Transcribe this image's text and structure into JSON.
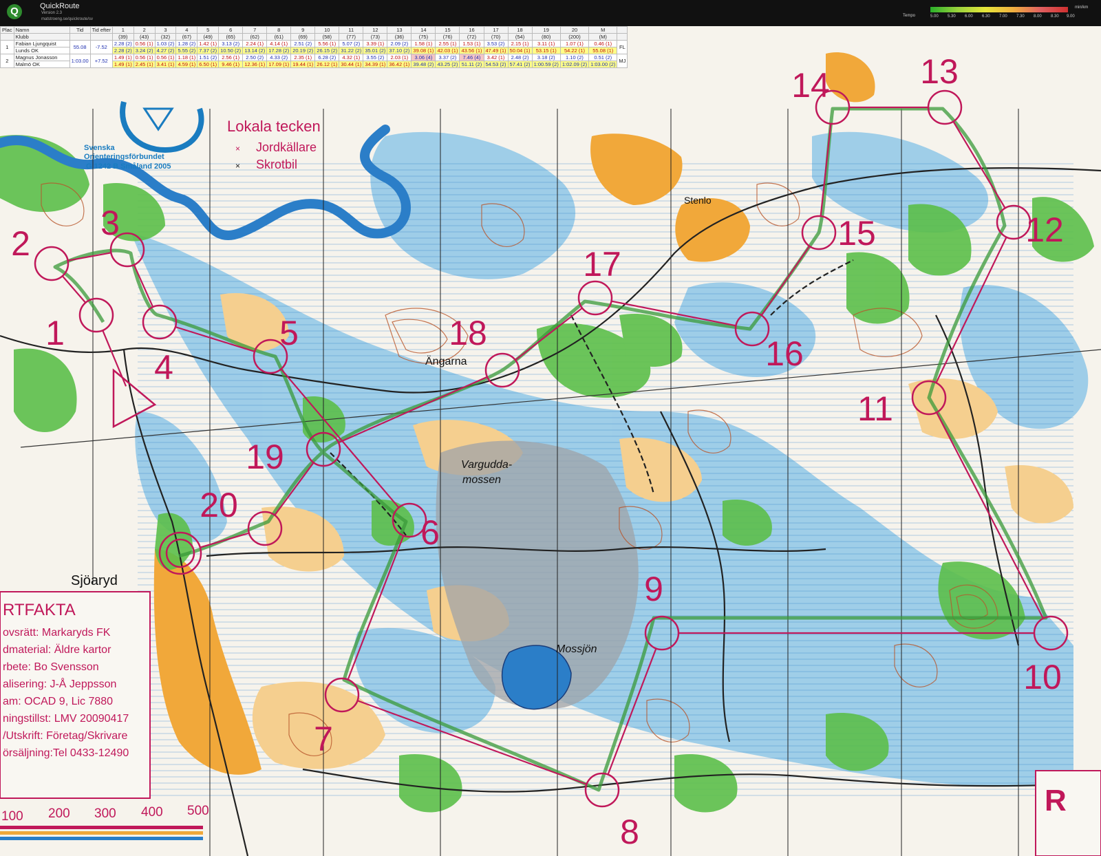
{
  "app": {
    "name": "QuickRoute",
    "version": "Version 2.3",
    "url": "matstroeng.se/quickroute/sv"
  },
  "tempo_legend": {
    "title": "Tempo",
    "ticks": [
      "5.00",
      "5.30",
      "6.00",
      "6.30",
      "7.00",
      "7.30",
      "8.00",
      "8.30",
      "9.00"
    ],
    "unit": "min/km"
  },
  "split_table": {
    "headers_top": [
      "Plac",
      "Namn",
      "Tid",
      "Tid efter",
      "1",
      "2",
      "3",
      "4",
      "5",
      "6",
      "7",
      "8",
      "9",
      "10",
      "11",
      "12",
      "13",
      "14",
      "15",
      "16",
      "17",
      "18",
      "19",
      "20",
      "M"
    ],
    "headers_bottom": [
      "",
      "Klubb",
      "",
      "",
      "(39)",
      "(43)",
      "(32)",
      "(67)",
      "(49)",
      "(65)",
      "(62)",
      "(61)",
      "(69)",
      "(58)",
      "(77)",
      "(73)",
      "(36)",
      "(75)",
      "(76)",
      "(72)",
      "(70)",
      "(54)",
      "(80)",
      "(200)",
      "(M)"
    ],
    "runners": [
      {
        "place": "1",
        "name": "Fabian Ljungquist",
        "club": "Lunds OK",
        "time": "55.08",
        "behind": "-7.52",
        "initials": "FL",
        "legs": [
          "2.28 (2)",
          "0.56 (1)",
          "1.03 (2)",
          "1.28 (2)",
          "1.42 (1)",
          "3.13 (2)",
          "2.24 (1)",
          "4.14 (1)",
          "2.51 (2)",
          "5.56 (1)",
          "5.07 (2)",
          "3.39 (1)",
          "2.09 (2)",
          "1.58 (1)",
          "2.55 (1)",
          "1.53 (1)",
          "3.53 (2)",
          "2.15 (1)",
          "3.11 (1)",
          "1.07 (1)",
          "0.46 (1)"
        ],
        "cumulative": [
          "2.28 (2)",
          "3.24 (2)",
          "4.27 (2)",
          "5.55 (2)",
          "7.37 (2)",
          "10.50 (2)",
          "13.14 (2)",
          "17.28 (2)",
          "20.19 (2)",
          "26.15 (2)",
          "31.22 (2)",
          "35.01 (2)",
          "37.10 (2)",
          "39.08 (1)",
          "42.03 (1)",
          "43.56 (1)",
          "47.49 (1)",
          "50.04 (1)",
          "53.15 (1)",
          "54.22 (1)",
          "55.08 (1)"
        ]
      },
      {
        "place": "2",
        "name": "Magnus Jonasson",
        "club": "Malmö OK",
        "time": "1:03.00",
        "behind": "+7.52",
        "initials": "MJ",
        "legs": [
          "1.49 (1)",
          "0.56 (1)",
          "0.56 (1)",
          "1.18 (1)",
          "1.51 (2)",
          "2.56 (1)",
          "2.50 (2)",
          "4.33 (2)",
          "2.35 (1)",
          "6.28 (2)",
          "4.32 (1)",
          "3.55 (2)",
          "2.03 (1)",
          "3.06 (4)",
          "3.37 (2)",
          "7.46 (4)",
          "3.42 (1)",
          "2.48 (2)",
          "3.18 (2)",
          "1.10 (2)",
          "0.51 (2)"
        ],
        "cumulative": [
          "1.49 (1)",
          "2.45 (1)",
          "3.41 (1)",
          "4.59 (1)",
          "6.50 (1)",
          "9.46 (1)",
          "12.36 (1)",
          "17.09 (1)",
          "19.44 (1)",
          "26.12 (1)",
          "30.44 (1)",
          "34.39 (1)",
          "36.42 (1)",
          "39.48 (2)",
          "43.25 (2)",
          "51.11 (2)",
          "54.53 (2)",
          "57.41 (2)",
          "1:00.59 (2)",
          "1:02.09 (2)",
          "1:03.00 (2)"
        ]
      }
    ]
  },
  "map": {
    "federation": "Svenska Orienteringsförbundet",
    "map_id": "G 1242 B Småland 2005",
    "legend_title": "Lokala tecken",
    "legend_items": [
      {
        "symbol": "×",
        "label": "Jordkällare"
      },
      {
        "symbol": "×",
        "label": "Skrotbil"
      }
    ],
    "place_names": [
      "Stenlo",
      "Ängarna",
      "Sjöaryd",
      "Vargudda-",
      "mossen",
      "Mossjön"
    ],
    "info_box": {
      "title": "RTFAKTA",
      "lines": [
        "ovsrätt: Markaryds FK",
        "dmaterial: Äldre kartor",
        "rbete: Bo Svensson",
        "alisering: J-Å Jeppsson",
        "am: OCAD 9, Lic 7880",
        "ningstillst: LMV 20090417",
        "/Utskrift: Företag/Skrivare",
        "örsäljning:Tel 0433-12490"
      ]
    },
    "scale_bar": [
      "100",
      "200",
      "300",
      "400",
      "500"
    ],
    "corner_label": "R",
    "controls": [
      "1",
      "2",
      "3",
      "4",
      "5",
      "6",
      "7",
      "8",
      "9",
      "10",
      "11",
      "12",
      "13",
      "14",
      "15",
      "16",
      "17",
      "18",
      "19",
      "20"
    ],
    "colors": {
      "course": "#c0185a",
      "water": "#2b7ec8",
      "open": "#f1a83a",
      "forest": "#5cbf4a",
      "marsh": "#8fc7e8",
      "contour": "#b8552a"
    }
  }
}
